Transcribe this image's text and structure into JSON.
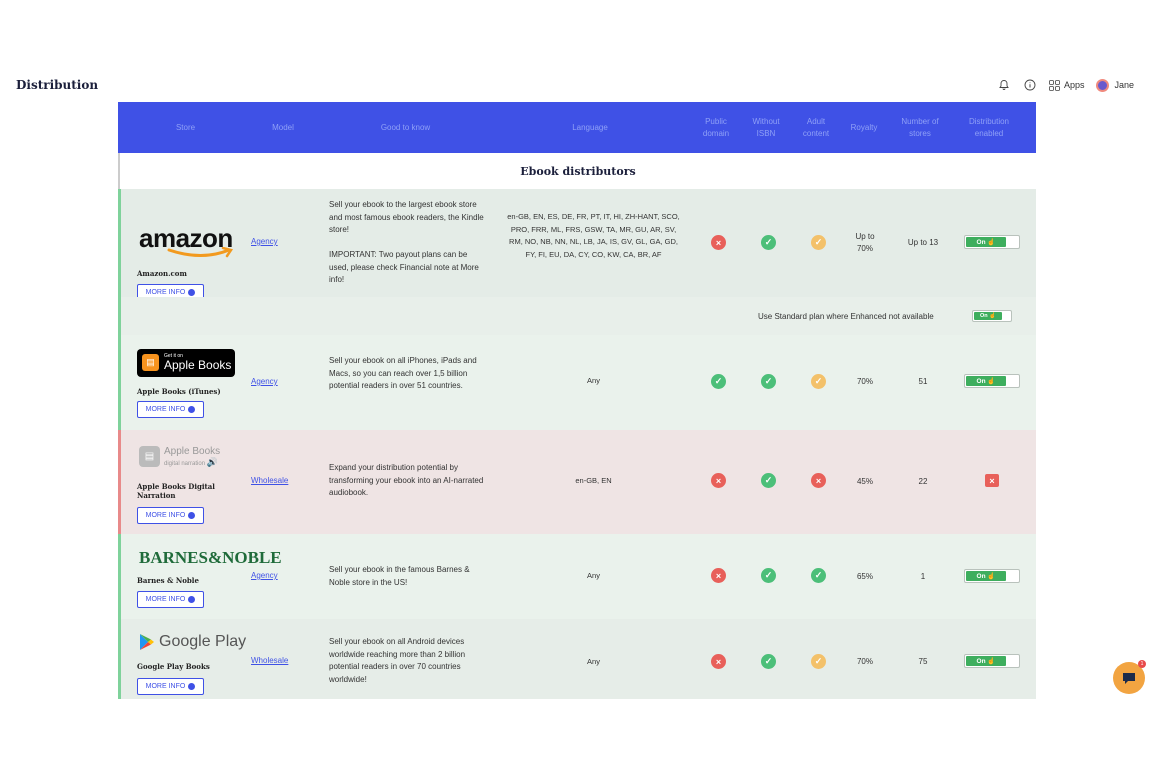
{
  "header": {
    "title": "Distribution",
    "apps_label": "Apps",
    "user_name": "Jane"
  },
  "columns": {
    "store": "Store",
    "model": "Model",
    "good_to_know": "Good to know",
    "language": "Language",
    "public_domain": "Public domain",
    "without_isbn": "Without ISBN",
    "adult_content": "Adult content",
    "royalty": "Royalty",
    "number_of_stores": "Number of stores",
    "distribution_enabled": "Distribution enabled"
  },
  "section_title": "Ebook distributors",
  "more_info_label": "MORE INFO",
  "toggle_on_label": "On",
  "stores": [
    {
      "logo": "amazon",
      "logo_text": "amazon",
      "name": "Amazon.com",
      "model": "Agency",
      "description": "Sell your ebook to the largest ebook store and most famous ebook readers, the Kindle store!\n\nIMPORTANT: Two payout plans can be used, please check Financial note at More info!",
      "languages": "en-GB, EN, ES, DE, FR, PT, IT, HI, ZH-HANT, SCO, PRO, FRR, ML, FRS, GSW, TA, MR, GU, AR, SV, RM, NO, NB, NN, NL, LB, JA, IS, GV, GL, GA, GD, FY, FI, EU, DA, CY, CO, KW, CA, BR, AF",
      "public_domain": "no",
      "without_isbn": "yes",
      "adult_content": "warn",
      "royalty": "Up to 70%",
      "number_of_stores": "Up to 13",
      "distribution": "on",
      "subnote": "Use Standard plan where Enhanced not available"
    },
    {
      "logo": "apple-books",
      "logo_small": "Get it on",
      "logo_text": "Apple Books",
      "name": "Apple Books (iTunes)",
      "model": "Agency",
      "description": "Sell your ebook on all iPhones, iPads and Macs, so you can reach over 1,5 billion potential readers in over 51 countries.",
      "languages": "Any",
      "public_domain": "yes",
      "without_isbn": "yes",
      "adult_content": "warn",
      "royalty": "70%",
      "number_of_stores": "51",
      "distribution": "on"
    },
    {
      "logo": "apple-books-narration",
      "logo_text": "Apple Books",
      "logo_small": "digital narration",
      "name": "Apple Books Digital Narration",
      "model": "Wholesale",
      "description": "Expand your distribution potential by transforming your ebook into an AI-narrated audiobook.",
      "languages": "en-GB, EN",
      "public_domain": "no",
      "without_isbn": "yes",
      "adult_content": "no",
      "royalty": "45%",
      "number_of_stores": "22",
      "distribution": "off"
    },
    {
      "logo": "barnes-noble",
      "logo_text": "BARNES&NOBLE",
      "name": "Barnes & Noble",
      "model": "Agency",
      "description": "Sell your ebook in the famous Barnes & Noble store in the US!",
      "languages": "Any",
      "public_domain": "no",
      "without_isbn": "yes",
      "adult_content": "yes",
      "royalty": "65%",
      "number_of_stores": "1",
      "distribution": "on"
    },
    {
      "logo": "google-play",
      "logo_text": "Google Play",
      "name": "Google Play Books",
      "model": "Wholesale",
      "description": "Sell your ebook on all Android devices worldwide reaching more than 2 billion potential readers in over 70 countries worldwide!",
      "languages": "Any",
      "public_domain": "no",
      "without_isbn": "yes",
      "adult_content": "warn",
      "royalty": "70%",
      "number_of_stores": "75",
      "distribution": "on"
    }
  ],
  "chat_badge_count": "1",
  "colors": {
    "header_blue": "#3f51e6",
    "yes": "#4cbf79",
    "no": "#e8605a",
    "warn": "#f3c16a"
  }
}
